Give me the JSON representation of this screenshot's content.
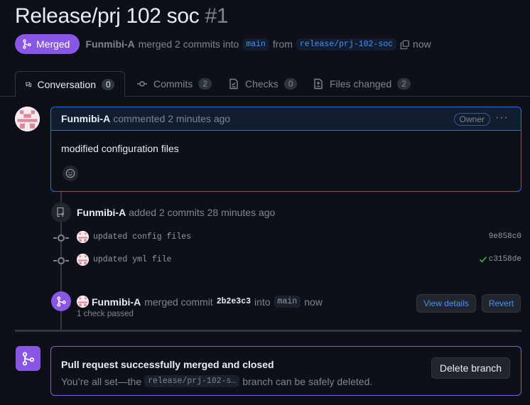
{
  "pr": {
    "title": "Release/prj 102 soc",
    "number": "#1",
    "state": "Merged",
    "author": "Funmibi-A",
    "merge_text": "merged 2 commits into",
    "base_branch": "main",
    "from_text": "from",
    "head_branch": "release/prj-102-soc",
    "time": "now"
  },
  "tabs": [
    {
      "label": "Conversation",
      "count": "0",
      "icon": "comment-discussion-icon"
    },
    {
      "label": "Commits",
      "count": "2",
      "icon": "git-commit-icon"
    },
    {
      "label": "Checks",
      "count": "0",
      "icon": "checklist-icon"
    },
    {
      "label": "Files changed",
      "count": "2",
      "icon": "file-diff-icon"
    }
  ],
  "comment": {
    "author": "Funmibi-A",
    "action": "commented 2 minutes ago",
    "badge": "Owner",
    "menu": "···",
    "body": "modified configuration files"
  },
  "timeline": {
    "commits_event": {
      "author": "Funmibi-A",
      "text": "added 2 commits 28 minutes ago"
    },
    "commits": [
      {
        "message": "updated config files",
        "sha": "9e858c0",
        "status": ""
      },
      {
        "message": "updated yml file",
        "sha": "c3158de",
        "status": "passed"
      }
    ],
    "merge_event": {
      "author": "Funmibi-A",
      "text": "merged commit",
      "sha": "2b2e3c3",
      "into": "into",
      "branch": "main",
      "time": "now",
      "checks": "1 check passed",
      "view_details": "View details",
      "revert": "Revert"
    }
  },
  "merge_box": {
    "title": "Pull request successfully merged and closed",
    "sub_prefix": "You’re all set—the",
    "branch": "release/prj-102-s…",
    "sub_suffix": "branch can be safely deleted.",
    "delete_button": "Delete branch"
  },
  "colors": {
    "merged_purple": "#8957e5",
    "link_blue": "#4493f8",
    "success_green": "#3fb950",
    "background": "#0d1117"
  }
}
